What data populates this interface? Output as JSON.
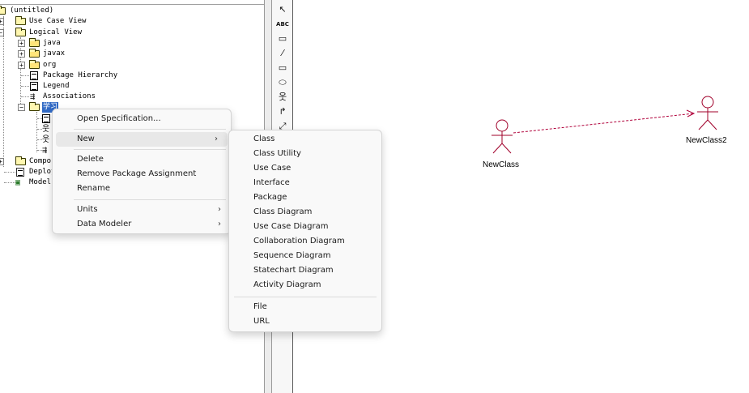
{
  "browser_tree": {
    "root": "(untitled)",
    "use_case_view": "Use Case View",
    "logical_view": "Logical View",
    "packages": [
      "java",
      "javax",
      "org"
    ],
    "package_hierarchy": "Package Hierarchy",
    "legend": "Legend",
    "associations": "Associations",
    "selected_package": "学习",
    "component_view": "Compor",
    "deployment_view": "Deploy",
    "model_properties": "Model",
    "expand_plus": "+",
    "collapse_minus": "−"
  },
  "toolbar": {
    "tools": [
      {
        "icon": "selection-arrow-icon",
        "glyph": "↖"
      },
      {
        "icon": "text-box-icon",
        "glyph": "ABC"
      },
      {
        "icon": "note-icon",
        "glyph": "▭"
      },
      {
        "icon": "anchor-note-icon",
        "glyph": "⁄"
      },
      {
        "icon": "package-icon",
        "glyph": "▭"
      },
      {
        "icon": "use-case-icon",
        "glyph": "⬭"
      },
      {
        "icon": "actor-icon",
        "glyph": "웃"
      },
      {
        "icon": "unidirectional-association-icon",
        "glyph": "↱"
      },
      {
        "icon": "dependency-icon",
        "glyph": "⤢"
      }
    ]
  },
  "canvas": {
    "actors": [
      {
        "name": "NewClass"
      },
      {
        "name": "NewClass2"
      }
    ],
    "dependency_color": "#b0003a",
    "actor_color": "#a0002a"
  },
  "context_menu": {
    "items": {
      "open_specification": "Open Specification...",
      "new": "New",
      "delete": "Delete",
      "remove_package_assignment": "Remove Package Assignment",
      "rename": "Rename",
      "units": "Units",
      "data_modeler": "Data Modeler"
    },
    "submenu_arrow": "›"
  },
  "new_submenu": {
    "items": [
      "Class",
      "Class Utility",
      "Use Case",
      "Interface",
      "Package",
      "Class Diagram",
      "Use Case Diagram",
      "Collaboration Diagram",
      "Sequence Diagram",
      "Statechart Diagram",
      "Activity Diagram"
    ],
    "file": "File",
    "url": "URL"
  }
}
